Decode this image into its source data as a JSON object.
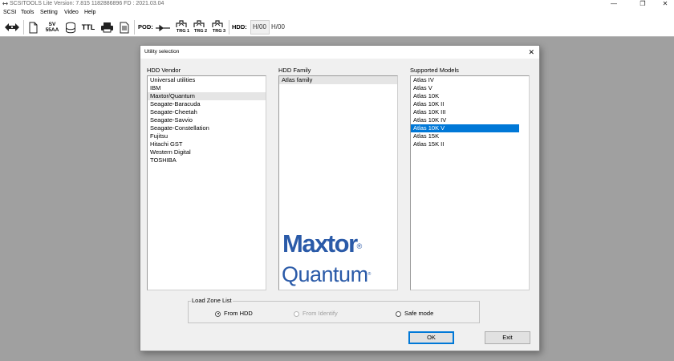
{
  "window": {
    "title": "SCSITOOLS Lite Version: 7.815   1182886896  FD : 2021.03.04",
    "minimize": "—",
    "maximize": "❐",
    "close": "✕"
  },
  "menu": [
    "SCSI",
    "Tools",
    "Setting",
    "Video",
    "Help"
  ],
  "toolbar": {
    "sv_top": "SV",
    "sv_bottom": "55AA",
    "ttl": "TTL",
    "pod_label": "POD:",
    "trg1": "TRG 1",
    "trg2": "TRG 2",
    "trg3": "TRG 3",
    "hdd_label": "HDD:",
    "hdd_box": "H/00",
    "hdd_value": "H/00"
  },
  "dialog": {
    "title": "Utility selection",
    "close": "✕",
    "vendor_label": "HDD Vendor",
    "family_label": "HDD Family",
    "models_label": "Supported Models",
    "vendors": [
      "Universal utilities",
      "IBM",
      "Maxtor/Quantum",
      "Seagate-Baracuda",
      "Seagate-Cheetah",
      "Seagate-Savvio",
      "Seagate-Constellation",
      "Fujitsu",
      "Hitachi GST",
      "Western Digital",
      "TOSHIBA"
    ],
    "families": [
      "Atlas family"
    ],
    "models": [
      "Atlas IV",
      "Atlas V",
      "Atlas 10K",
      "Atlas 10K II",
      "Atlas 10K III",
      "Atlas 10K IV",
      "Atlas 10K V",
      "Atlas 15K",
      "Atlas 15K II"
    ],
    "selected_vendor_index": 2,
    "selected_family_index": 0,
    "selected_model_index": 6,
    "logo_maxtor": "Maxtor",
    "logo_maxtor_reg": "®",
    "logo_quantum": "Quantum",
    "logo_quantum_reg": "®",
    "load_zone": {
      "legend": "Load Zone List",
      "from_hdd": "From HDD",
      "from_identify": "From Identify",
      "safe_mode": "Safe mode",
      "selected": "From HDD"
    },
    "ok": "OK",
    "exit": "Exit"
  },
  "colors": {
    "selection": "#0078d7",
    "logo_blue": "#2a5aa8",
    "workspace": "#a0a0a0"
  }
}
